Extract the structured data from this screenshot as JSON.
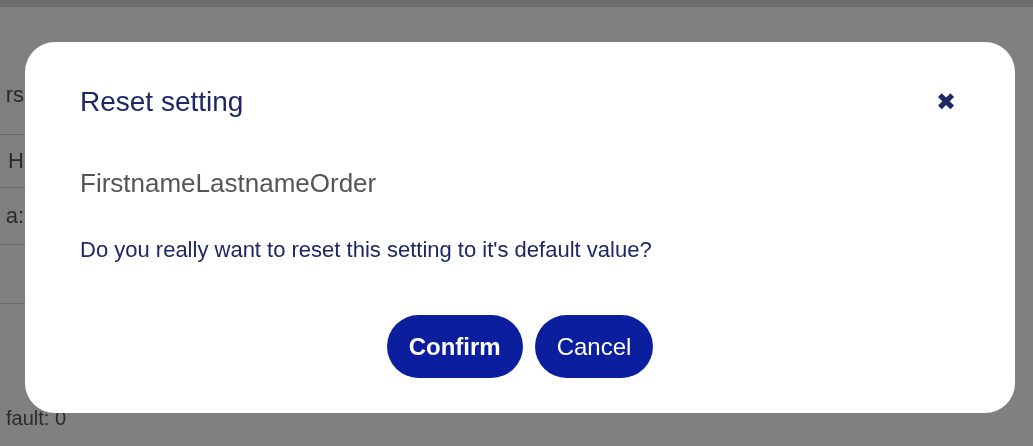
{
  "background": {
    "fragments": [
      {
        "text": "rs"
      },
      {
        "text": "H"
      },
      {
        "text": "a:"
      },
      {
        "text": "fault: 0"
      }
    ]
  },
  "dialog": {
    "title": "Reset setting",
    "close": "✖",
    "setting_name": "FirstnameLastnameOrder",
    "message": "Do you really want to reset this setting to it's default value?",
    "buttons": [
      {
        "label": "Confirm",
        "kind": "primary"
      },
      {
        "label": "Cancel",
        "kind": "secondary"
      }
    ]
  }
}
